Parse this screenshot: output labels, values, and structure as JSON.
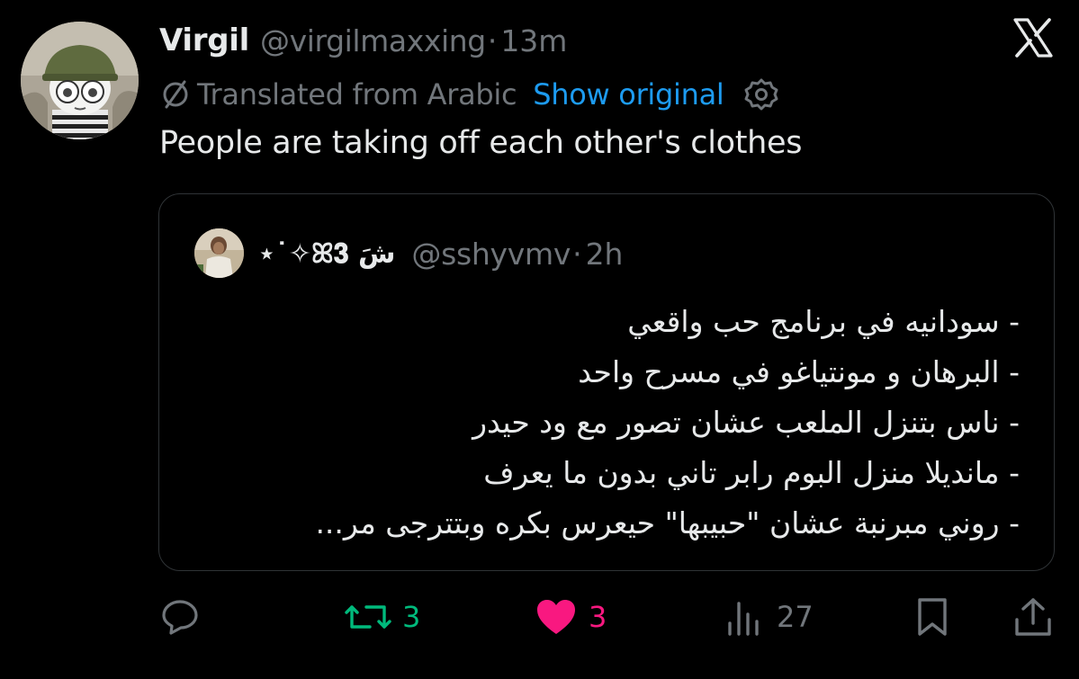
{
  "tweet": {
    "display_name": "Virgil",
    "handle": "@virgilmaxxing",
    "separator": "·",
    "time": "13m",
    "translated_label": "Translated from Arabic",
    "show_original_label": "Show original",
    "text": "People are taking off each other's clothes"
  },
  "quote": {
    "display_name": "⋆˙✧ꕤ𝟑 شَ",
    "handle": "@sshyvmv",
    "separator": "·",
    "time": "2h",
    "lines": [
      "- سودانيه في برنامج حب واقعي",
      "- البرهان و مونتياغو في مسرح واحد",
      "- ناس بتنزل الملعب عشان تصور مع ود حيدر",
      "- مانديلا منزل البوم رابر تاني بدون ما يعرف",
      "- روني مبرنبة عشان \"حبيبها\" حيعرس بكره وبتترجى مر..."
    ]
  },
  "actions": {
    "reply_icon": "reply-icon",
    "repost_icon": "repost-icon",
    "repost_count": "3",
    "like_icon": "heart-icon",
    "like_count": "3",
    "views_icon": "views-icon",
    "views_count": "27",
    "bookmark_icon": "bookmark-icon",
    "share_icon": "share-icon"
  },
  "colors": {
    "background": "#000000",
    "primary_text": "#e7e9ea",
    "secondary_text": "#71767b",
    "link": "#1d9bf0",
    "repost": "#00ba7c",
    "like": "#f91880",
    "border": "#2f3336"
  }
}
